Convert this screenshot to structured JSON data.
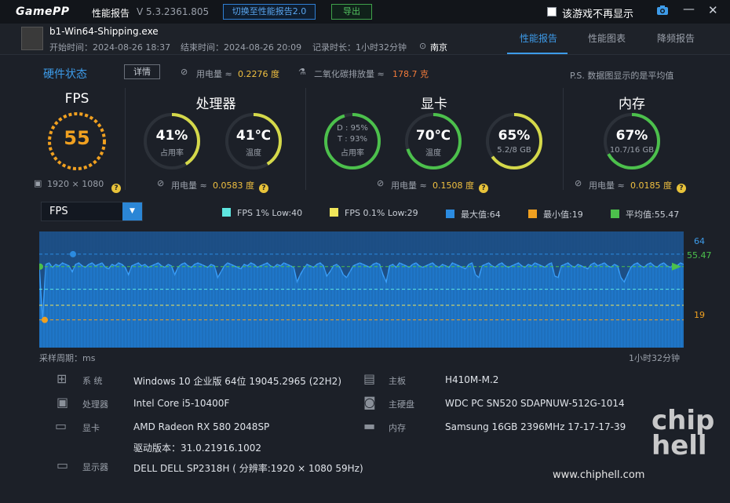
{
  "titlebar": {
    "logo": "GamePP",
    "title": "性能报告",
    "version": "V 5.3.2361.805",
    "switch_label": "切换至性能报告2.0",
    "export_label": "导出",
    "no_show_label": "该游戏不再显示"
  },
  "game": {
    "name": "b1-Win64-Shipping.exe",
    "start": "开始时间：2024-08-26 18:37",
    "end": "结束时间：2024-08-26 20:09",
    "duration": "记录时长：1小时32分钟",
    "location": "南京"
  },
  "tabs": [
    "性能报告",
    "性能图表",
    "降频报告"
  ],
  "hw": {
    "title": "硬件状态",
    "detail": "详情",
    "power_label": "用电量 ≈",
    "power_value": "0.2276 度",
    "co2_label": "二氧化碳排放量 ≈",
    "co2_value": "178.7 克",
    "note": "P.S. 数据图显示的是平均值"
  },
  "fps": {
    "title": "FPS",
    "value": "55",
    "resolution": "1920 × 1080"
  },
  "cpu": {
    "title": "处理器",
    "usage": "41%",
    "usage_label": "占用率",
    "temp": "41℃",
    "temp_label": "温度",
    "power_label": "用电量 ≈",
    "power_value": "0.0583 度"
  },
  "gpu": {
    "title": "显卡",
    "d": "D : 95%",
    "t": "T : 93%",
    "usage_label": "占用率",
    "temp": "70℃",
    "temp_label": "温度",
    "mem": "65%",
    "mem_sub": "5.2/8 GB",
    "power_label": "用电量 ≈",
    "power_value": "0.1508 度"
  },
  "ram": {
    "title": "内存",
    "value": "67%",
    "sub": "10.7/16 GB",
    "power_label": "用电量 ≈",
    "power_value": "0.0185 度"
  },
  "metric_select": "FPS",
  "legend": [
    {
      "label": "FPS 1% Low:40",
      "color": "#5ee6e0"
    },
    {
      "label": "FPS 0.1% Low:29",
      "color": "#f0e65a"
    },
    {
      "label": "最大值:64",
      "color": "#2b8be0"
    },
    {
      "label": "最小值:19",
      "color": "#f0a020"
    },
    {
      "label": "平均值:55.47",
      "color": "#4cc04c"
    }
  ],
  "chart_axis": {
    "max": "64",
    "avg": "55.47",
    "min": "19",
    "x_left": "采样周期：ms",
    "x_right": "1小时32分钟"
  },
  "chart_data": {
    "type": "area",
    "ylim": [
      0,
      70
    ],
    "max": 64,
    "min": 19,
    "avg": 55.47,
    "low1": 40,
    "low01": 29,
    "values": [
      56,
      19,
      57,
      58,
      55,
      57,
      56,
      58,
      57,
      56,
      52,
      57,
      58,
      56,
      55,
      57,
      58,
      56,
      57,
      58,
      55,
      54,
      57,
      56,
      58,
      57,
      55,
      50,
      56,
      57,
      58,
      56,
      57,
      55,
      56,
      57,
      58,
      56,
      55,
      57,
      56,
      50,
      55,
      57,
      58,
      56,
      55,
      57,
      58,
      57,
      56,
      55,
      57,
      56,
      48,
      52,
      56,
      58,
      57,
      56,
      55,
      54,
      57,
      56,
      58,
      57,
      55,
      56,
      57,
      58,
      56,
      55,
      57,
      56,
      58,
      57,
      56,
      55,
      45,
      50,
      54,
      57,
      56,
      55,
      57,
      58,
      56,
      49,
      52,
      56,
      57,
      55,
      50,
      48,
      52,
      56,
      57,
      58,
      57,
      56,
      55,
      57,
      58,
      57,
      50,
      45,
      56,
      57,
      55,
      58,
      57,
      56,
      55,
      57,
      58,
      56,
      55,
      56,
      57,
      58,
      56,
      55,
      57,
      56,
      55,
      58,
      57,
      56,
      55,
      54,
      57,
      58,
      50,
      48,
      56,
      57,
      58,
      56,
      55,
      57,
      58,
      56,
      55,
      56,
      57,
      58,
      56,
      55,
      57,
      56,
      58,
      57,
      56,
      55,
      57,
      58,
      49,
      48,
      56,
      57,
      58,
      56,
      55,
      57,
      56,
      55,
      54,
      57,
      58,
      56,
      57,
      58,
      56,
      55,
      57,
      56,
      48,
      45,
      50,
      55,
      57,
      58,
      56,
      55,
      57,
      58,
      56,
      55,
      57,
      58,
      56,
      55,
      57,
      56,
      58,
      57
    ]
  },
  "info": {
    "os_k": "系  统",
    "os_v": "Windows 10 企业版 64位 19045.2965 (22H2)",
    "cpu_k": "处理器",
    "cpu_v": "Intel Core i5-10400F",
    "gpu_k": "显卡",
    "gpu_v": "AMD Radeon RX 580 2048SP",
    "driver_v": "驱动版本：31.0.21916.1002",
    "mon_k": "显示器",
    "mon_v": "DELL DELL SP2318H ( 分辨率:1920 × 1080 59Hz)",
    "mb_k": "主板",
    "mb_v": "H410M-M.2",
    "disk_k": "主硬盘",
    "disk_v": "WDC PC SN520 SDAPNUW-512G-1014",
    "mem_k": "内存",
    "mem_v": "Samsung 16GB 2396MHz 17-17-17-39"
  },
  "watermark": {
    "logo": "chip hell",
    "url": "www.chiphell.com"
  }
}
